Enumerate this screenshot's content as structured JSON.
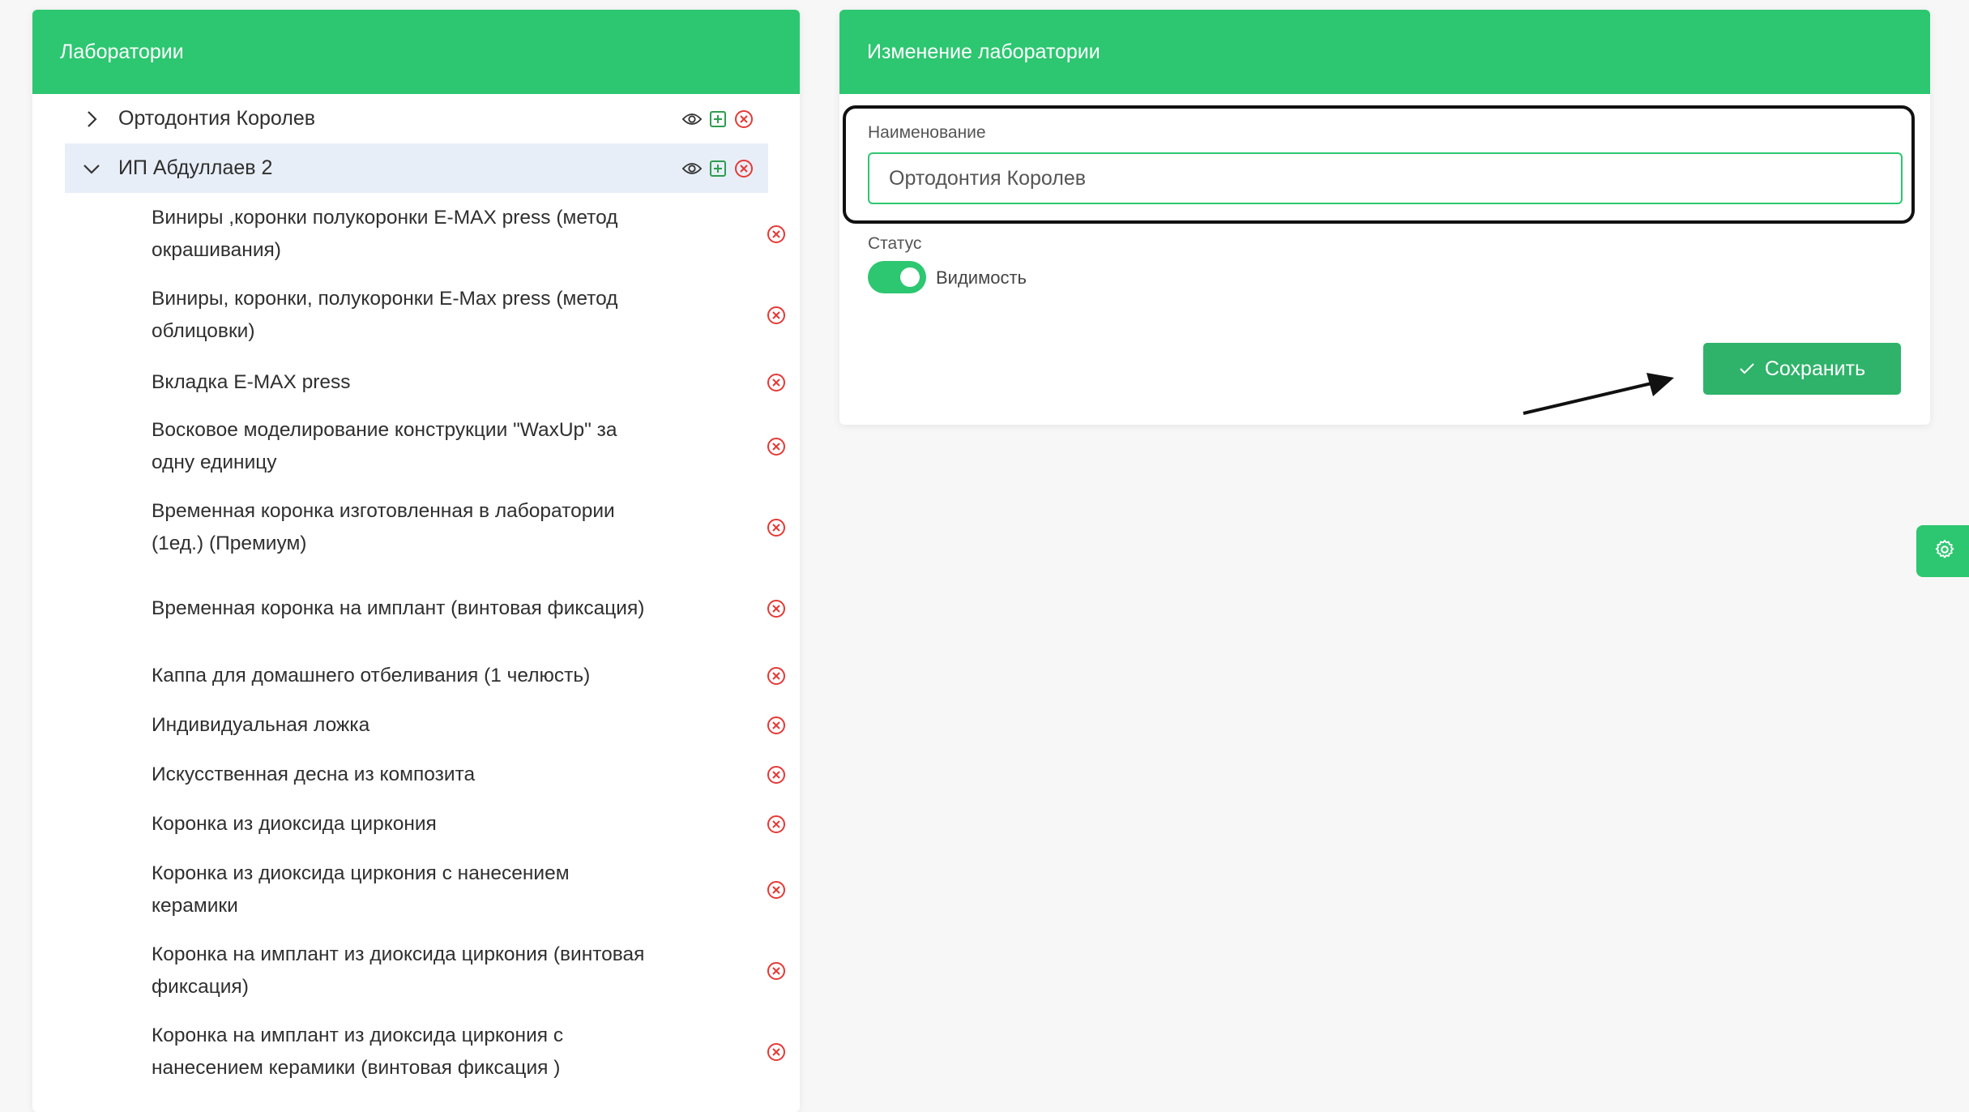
{
  "left_panel": {
    "title": "Лаборатории",
    "parents": [
      {
        "label": "Ортодонтия Королев",
        "expanded": false
      },
      {
        "label": "ИП Абдуллаев 2",
        "expanded": true
      }
    ],
    "children": [
      "Виниры ,коронки полукоронки E-MAX press (метод окрашивания)",
      "Виниры, коронки, полукоронки E-Max press (метод облицовки)",
      "Вкладка E-MAX press",
      "Восковое моделирование конструкции \"WaxUp\" за одну единицу",
      "Временная коронка изготовленная в лаборатории (1ед.) (Премиум)",
      "Временная коронка на имплант (винтовая фиксация)",
      "Каппа для домашнего отбеливания (1 челюсть)",
      "Индивидуальная ложка",
      "Искусственная десна из композита",
      "Коронка из диоксида циркония",
      "Коронка из диоксида циркония с нанесением керамики",
      "Коронка на имплант из диоксида циркония (винтовая фиксация)",
      "Коронка на имплант из диоксида циркония с нанесением керамики (винтовая фиксация )"
    ]
  },
  "right_panel": {
    "title": "Изменение лаборатории",
    "name_label": "Наименование",
    "name_value": "Ортодонтия Королев",
    "status_label": "Статус",
    "visibility_label": "Видимость",
    "visibility_on": true,
    "save_label": "Сохранить"
  },
  "icons": {
    "view": "eye-icon",
    "add": "plus-square-icon",
    "delete": "close-circle-icon",
    "settings": "gear-icon"
  },
  "colors": {
    "accent": "#2cc770",
    "button": "#2fb36a",
    "delete": "#e53935",
    "active_row": "#e8eef8"
  }
}
